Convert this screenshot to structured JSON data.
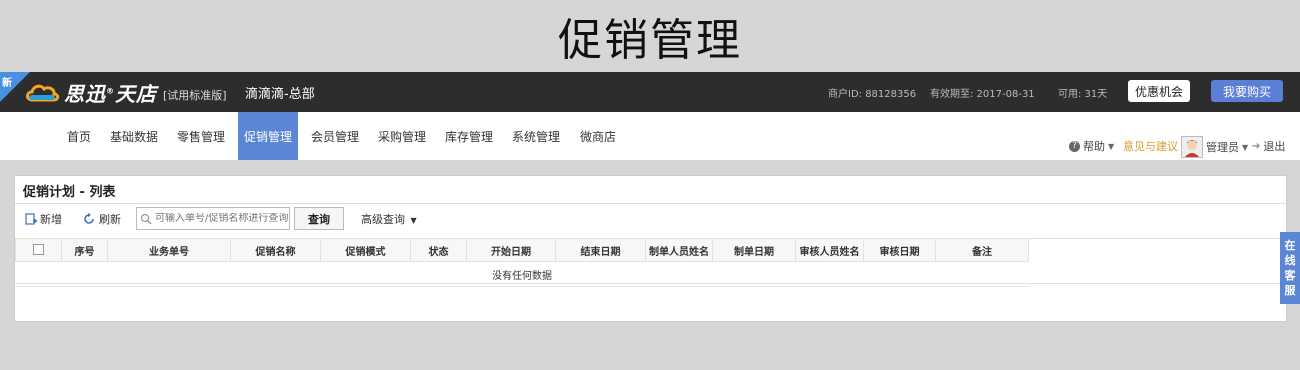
{
  "page_title": "促销管理",
  "topbar": {
    "new_badge": "新",
    "logo_text": "思迅",
    "logo_mark": "®",
    "logo_text2": "天店",
    "logo_edition": "[试用标准版]",
    "store_name": "滴滴滴-总部",
    "merchant_id": "商户ID: 88128356",
    "expire": "有效期至: 2017-08-31",
    "available": "可用: 31天",
    "promo_button": "优惠机会",
    "buy_button": "我要购买",
    "colors": {
      "bg": "#2d2d2d",
      "accent": "#5b7fd6"
    }
  },
  "nav": {
    "items": [
      {
        "label": "首页"
      },
      {
        "label": "基础数据"
      },
      {
        "label": "零售管理"
      },
      {
        "label": "促销管理",
        "active": true
      },
      {
        "label": "会员管理"
      },
      {
        "label": "采购管理"
      },
      {
        "label": "库存管理"
      },
      {
        "label": "系统管理"
      },
      {
        "label": "微商店"
      }
    ],
    "help": "帮助",
    "feedback": "意见与建议",
    "admin": "管理员",
    "logout": "退出",
    "active_color": "#5b86d6"
  },
  "panel": {
    "title": "促销计划 - 列表",
    "toolbar": {
      "add": "新增",
      "refresh": "刷新",
      "search_placeholder": "可输入单号/促销名称进行查询",
      "query": "查询",
      "advanced": "高级查询"
    },
    "columns": [
      "序号",
      "业务单号",
      "促销名称",
      "促销模式",
      "状态",
      "开始日期",
      "结束日期",
      "制单人员姓名",
      "制单日期",
      "审核人员姓名",
      "审核日期",
      "备注"
    ],
    "empty_text": "没有任何数据"
  },
  "side_service": [
    "在",
    "线",
    "客",
    "服"
  ]
}
